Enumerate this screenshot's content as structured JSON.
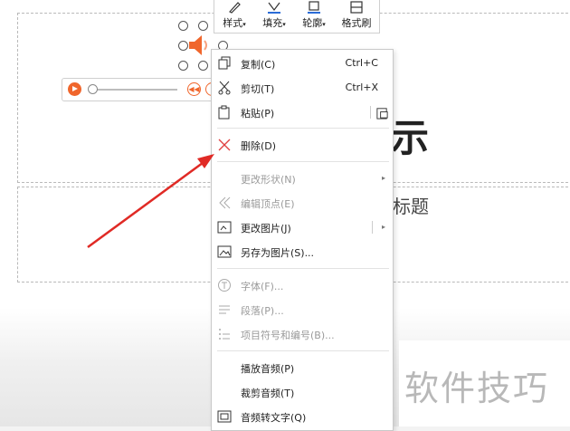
{
  "slide": {
    "title_fragment": "示",
    "subtitle_fragment": "标题"
  },
  "mini_toolbar": {
    "items": [
      {
        "label": "样式",
        "icon": "pen-icon"
      },
      {
        "label": "填充",
        "icon": "fill-icon"
      },
      {
        "label": "轮廓",
        "icon": "outline-icon"
      },
      {
        "label": "格式刷",
        "icon": "format-painter-icon"
      }
    ]
  },
  "context_menu": {
    "items": [
      {
        "label": "复制(C)",
        "shortcut": "Ctrl+C",
        "icon": "copy-icon",
        "enabled": true
      },
      {
        "label": "剪切(T)",
        "shortcut": "Ctrl+X",
        "icon": "cut-icon",
        "enabled": true
      },
      {
        "label": "粘贴(P)",
        "shortcut": "",
        "icon": "paste-icon",
        "enabled": true
      },
      {
        "label": "删除(D)",
        "shortcut": "",
        "icon": "delete-icon",
        "enabled": true
      },
      {
        "label": "更改形状(N)",
        "shortcut": "",
        "icon": "",
        "enabled": false
      },
      {
        "label": "编辑顶点(E)",
        "shortcut": "",
        "icon": "edit-vertex-icon",
        "enabled": false
      },
      {
        "label": "更改图片(J)",
        "shortcut": "",
        "icon": "change-picture-icon",
        "enabled": true
      },
      {
        "label": "另存为图片(S)...",
        "shortcut": "",
        "icon": "save-picture-icon",
        "enabled": true
      },
      {
        "label": "字体(F)...",
        "shortcut": "",
        "icon": "font-icon",
        "enabled": false
      },
      {
        "label": "段落(P)...",
        "shortcut": "",
        "icon": "paragraph-icon",
        "enabled": false
      },
      {
        "label": "项目符号和编号(B)...",
        "shortcut": "",
        "icon": "bullets-icon",
        "enabled": false
      },
      {
        "label": "播放音频(P)",
        "shortcut": "",
        "icon": "",
        "enabled": true
      },
      {
        "label": "裁剪音频(T)",
        "shortcut": "",
        "icon": "",
        "enabled": true
      },
      {
        "label": "音频转文字(Q)",
        "shortcut": "",
        "icon": "audio-to-text-icon",
        "enabled": true
      }
    ]
  },
  "watermark": "软件技巧",
  "colors": {
    "accent_orange": "#f0662c",
    "annotation_red": "#e02a25"
  }
}
